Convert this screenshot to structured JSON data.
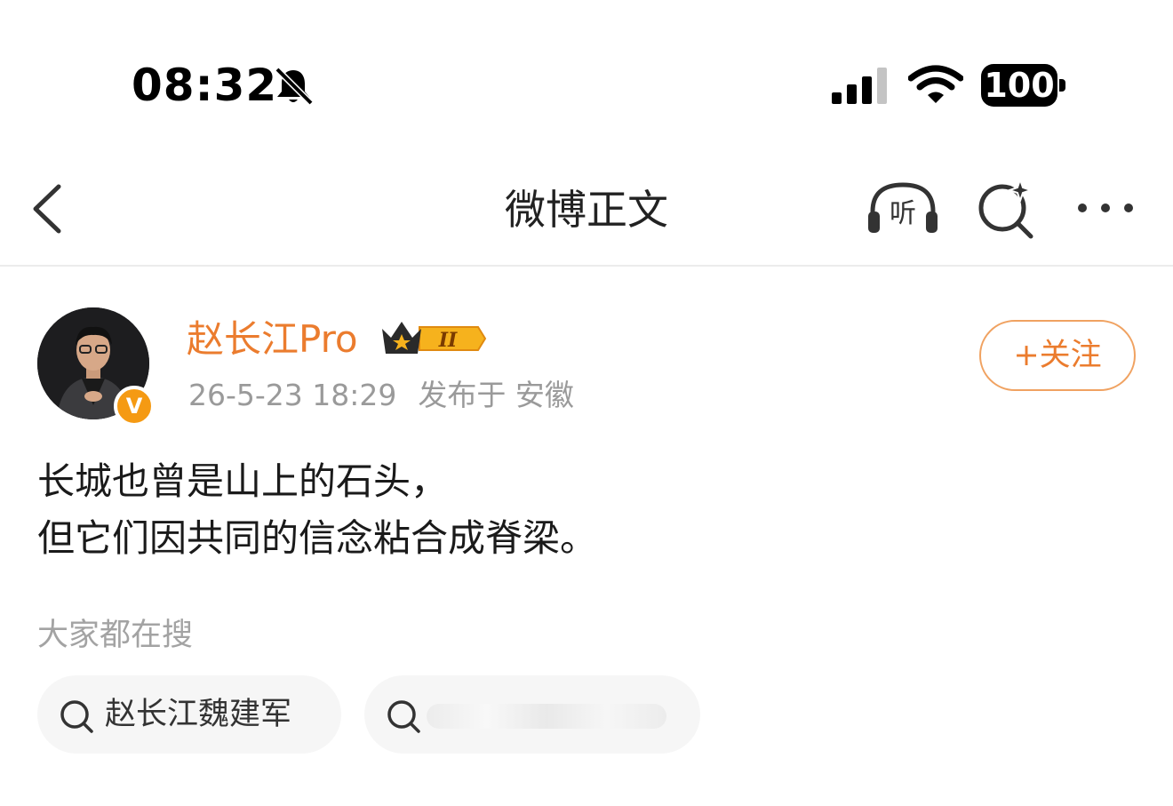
{
  "status_bar": {
    "time": "08:32",
    "battery": "100",
    "icons": [
      "bell-slash-icon",
      "signal-icon",
      "wifi-icon",
      "battery-icon"
    ]
  },
  "nav": {
    "title": "微博正文",
    "listen_label": "听",
    "icons": [
      "back-chevron-icon",
      "headphones-listen-icon",
      "search-sparkle-icon",
      "more-dots-icon"
    ]
  },
  "post": {
    "author": "赵长江Pro",
    "level_badge": "II",
    "verified_badge": "V",
    "timestamp": "26-5-23 18:29",
    "location": "发布于 安徽",
    "follow_label": "+关注",
    "lines": [
      "长城也曾是山上的石头，",
      "但它们因共同的信念粘合成脊梁。"
    ]
  },
  "suggestions": {
    "label": "大家都在搜",
    "items": [
      "赵长江魏建军"
    ]
  },
  "colors": {
    "brand_orange": "#eb7c2e",
    "follow_border": "#f0a261",
    "meta_gray": "#9a9a9a",
    "chip_bg": "#f6f6f6"
  }
}
